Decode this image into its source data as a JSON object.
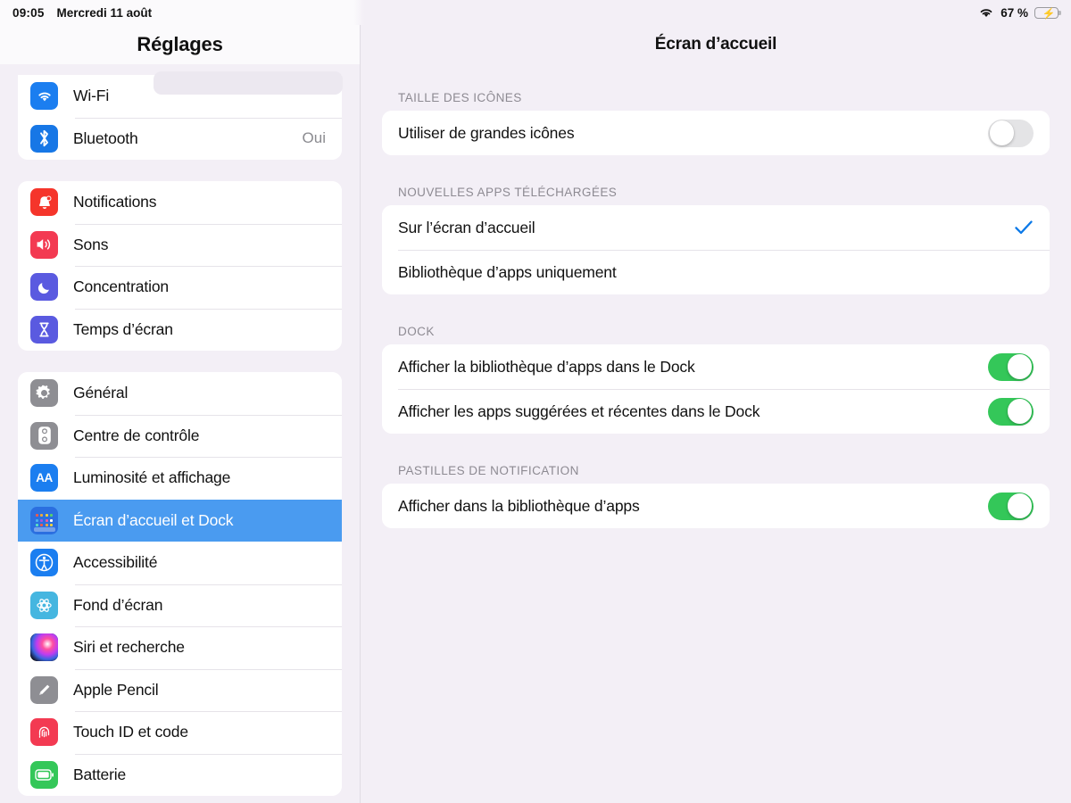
{
  "statusbar": {
    "time": "09:05",
    "date": "Mercredi 11 août",
    "battery_percent": "67 %",
    "wifi_icon": "wifi-icon",
    "battery_icon": "battery-charging-icon"
  },
  "sidebar": {
    "title": "Réglages",
    "groups": [
      {
        "name": "connectivity",
        "partial": true,
        "items": [
          {
            "label": "Wi-Fi",
            "value": "",
            "icon": "wifi-app-icon",
            "selected": false
          },
          {
            "label": "Bluetooth",
            "value": "Oui",
            "icon": "bluetooth-icon",
            "selected": false
          }
        ]
      },
      {
        "name": "alerts",
        "partial": false,
        "items": [
          {
            "label": "Notifications",
            "value": "",
            "icon": "bell-icon",
            "selected": false
          },
          {
            "label": "Sons",
            "value": "",
            "icon": "speaker-icon",
            "selected": false
          },
          {
            "label": "Concentration",
            "value": "",
            "icon": "moon-icon",
            "selected": false
          },
          {
            "label": "Temps d’écran",
            "value": "",
            "icon": "hourglass-icon",
            "selected": false
          }
        ]
      },
      {
        "name": "system",
        "partial": false,
        "items": [
          {
            "label": "Général",
            "value": "",
            "icon": "gear-icon",
            "selected": false
          },
          {
            "label": "Centre de contrôle",
            "value": "",
            "icon": "control-center-icon",
            "selected": false
          },
          {
            "label": "Luminosité et affichage",
            "value": "",
            "icon": "display-aa-icon",
            "selected": false
          },
          {
            "label": "Écran d’accueil et Dock",
            "value": "",
            "icon": "home-screen-icon",
            "selected": true
          },
          {
            "label": "Accessibilité",
            "value": "",
            "icon": "accessibility-icon",
            "selected": false
          },
          {
            "label": "Fond d’écran",
            "value": "",
            "icon": "wallpaper-icon",
            "selected": false
          },
          {
            "label": "Siri et recherche",
            "value": "",
            "icon": "siri-icon",
            "selected": false
          },
          {
            "label": "Apple Pencil",
            "value": "",
            "icon": "pencil-icon",
            "selected": false
          },
          {
            "label": "Touch ID et code",
            "value": "",
            "icon": "fingerprint-icon",
            "selected": false
          },
          {
            "label": "Batterie",
            "value": "",
            "icon": "battery-icon",
            "selected": false
          }
        ]
      }
    ]
  },
  "main": {
    "title": "Écran d’accueil",
    "sections": [
      {
        "header": "TAILLE DES ICÔNES",
        "rows": [
          {
            "label": "Utiliser de grandes icônes",
            "control": "toggle",
            "state": "off"
          }
        ]
      },
      {
        "header": "NOUVELLES APPS TÉLÉCHARGÉES",
        "rows": [
          {
            "label": "Sur l’écran d’accueil",
            "control": "check",
            "state": "checked"
          },
          {
            "label": "Bibliothèque d’apps uniquement",
            "control": "none",
            "state": ""
          }
        ]
      },
      {
        "header": "DOCK",
        "rows": [
          {
            "label": "Afficher la bibliothèque d’apps dans le Dock",
            "control": "toggle",
            "state": "on"
          },
          {
            "label": "Afficher les apps suggérées et récentes dans le Dock",
            "control": "toggle",
            "state": "on"
          }
        ]
      },
      {
        "header": "PASTILLES DE NOTIFICATION",
        "rows": [
          {
            "label": "Afficher dans la bibliothèque d’apps",
            "control": "toggle",
            "state": "on"
          }
        ]
      }
    ]
  },
  "colors": {
    "accent_blue": "#0b79e8",
    "selected_row": "#4a9bf0",
    "toggle_on": "#34c759",
    "toggle_off": "#e4e4e6",
    "background": "#f3eff6",
    "card": "#ffffff"
  }
}
